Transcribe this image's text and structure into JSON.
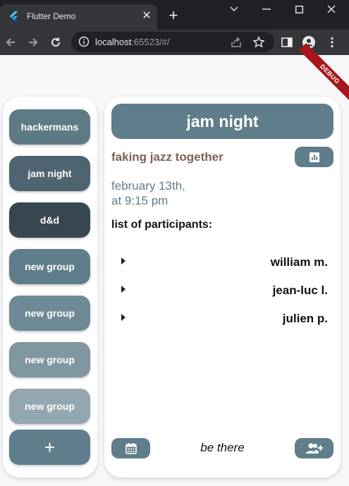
{
  "browser": {
    "tab_title": "Flutter Demo",
    "url_host": "localhost",
    "url_rest": ":65523/#/"
  },
  "app": {
    "debug_banner": "DEBUG",
    "groups": [
      {
        "label": "hackermans",
        "color": "#5f7a87"
      },
      {
        "label": "jam night",
        "color": "#4e6470"
      },
      {
        "label": "d&d",
        "color": "#37474f"
      },
      {
        "label": "new group",
        "color": "#607d8b"
      },
      {
        "label": "new group",
        "color": "#6f8a96"
      },
      {
        "label": "new group",
        "color": "#8096a1"
      },
      {
        "label": "new group",
        "color": "#93a7b1"
      }
    ],
    "add_label": "+",
    "detail": {
      "title": "jam night",
      "subtitle": "faking jazz together",
      "date_line1": "february 13th,",
      "date_line2": "at 9:15 pm",
      "list_heading": "list of participants:",
      "participants": [
        "william m.",
        "jean-luc l.",
        "julien p."
      ],
      "rsvp_text": "be there"
    }
  }
}
